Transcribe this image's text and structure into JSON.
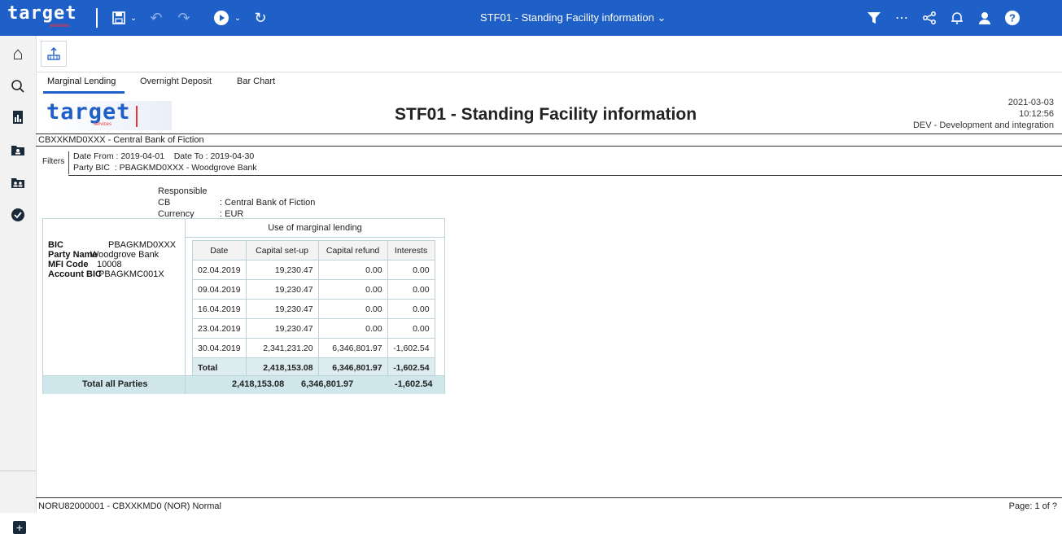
{
  "topbar": {
    "brand": "target",
    "brand_sub": "services",
    "title": "STF01 - Standing Facility information",
    "icons": [
      "save-icon",
      "undo-icon",
      "redo-icon",
      "play-icon",
      "refresh-icon",
      "filter-icon",
      "more-icon",
      "share-icon",
      "bell-icon",
      "user-icon",
      "help-icon"
    ]
  },
  "tabs": [
    "Marginal Lending",
    "Overnight Deposit",
    "Bar Chart"
  ],
  "report": {
    "logo": "target",
    "logo_sub": "services",
    "title": "STF01 - Standing Facility information",
    "date": "2021-03-03",
    "time": "10:12:56",
    "env": "DEV - Development and integration",
    "cb_line": "CBXXKMD0XXX - Central Bank of Fiction",
    "filters_label": "Filters",
    "filter_line1": "Date From : 2019-04-01    Date To : 2019-04-30",
    "filter_line2": "Party BIC  : PBAGKMD0XXX - Woodgrove Bank",
    "responsible_label": "Responsible CB",
    "responsible_value": ": Central Bank of Fiction",
    "currency_label": "Currency",
    "currency_value": ": EUR"
  },
  "table": {
    "heading": "Use of marginal lending",
    "info": {
      "bic_label": "BIC",
      "bic": "PBAGKMD0XXX",
      "party_label": "Party Name",
      "party": "Woodgrove Bank",
      "mfi_label": "MFI Code",
      "mfi": "10008",
      "acct_label": "Account BIC",
      "acct": "PBAGKMC001X"
    },
    "columns": [
      "Date",
      "Capital set-up",
      "Capital refund",
      "Interests"
    ],
    "rows": [
      [
        "02.04.2019",
        "19,230.47",
        "0.00",
        "0.00"
      ],
      [
        "09.04.2019",
        "19,230.47",
        "0.00",
        "0.00"
      ],
      [
        "16.04.2019",
        "19,230.47",
        "0.00",
        "0.00"
      ],
      [
        "23.04.2019",
        "19,230.47",
        "0.00",
        "0.00"
      ],
      [
        "30.04.2019",
        "2,341,231.20",
        "6,346,801.97",
        "-1,602.54"
      ]
    ],
    "total": [
      "Total",
      "2,418,153.08",
      "6,346,801.97",
      "-1,602.54"
    ],
    "grand": {
      "label": "Total all Parties",
      "setup": "2,418,153.08",
      "refund": "6,346,801.97",
      "interests": "-1,602.54"
    }
  },
  "footer": {
    "left": "NORU82000001 - CBXXKMD0 (NOR) Normal",
    "right": "Page: 1 of ?"
  }
}
